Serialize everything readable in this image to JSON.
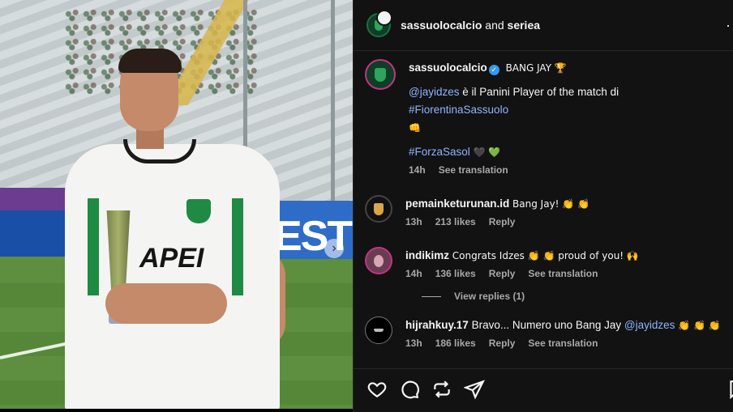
{
  "header": {
    "account": "sassuolocalcio",
    "joiner": "and",
    "collaborator": "seriea",
    "more": "·"
  },
  "photo": {
    "sponsor": "APEI",
    "board_text": "EST"
  },
  "caption": {
    "username": "sassuolocalcio",
    "verified": "✓",
    "title": "BANG JAY 🏆",
    "mention": "@jayidzes",
    "text": " è il Panini Player of the match di ",
    "hashtag": "#FiorentinaSassuolo",
    "emoji_line": "👊",
    "tag2": "#ForzaSasol",
    "tag2_emoji": "🖤 💚",
    "time": "14h",
    "translate": "See translation"
  },
  "comments": [
    {
      "username": "pemainketurunan.id",
      "text": "Bang Jay! 👏 👏",
      "time": "13h",
      "likes": "213 likes",
      "reply": "Reply",
      "translate": ""
    },
    {
      "username": "indikimz",
      "text": "Congrats Idzes 👏 👏 proud of you! 🙌",
      "time": "14h",
      "likes": "136 likes",
      "reply": "Reply",
      "translate": "See translation",
      "view_replies": "View replies (1)"
    },
    {
      "username": "hijrahkuy.17",
      "text_pre": "Bravo... Numero uno Bang Jay ",
      "mention": "@jayidzes",
      "text_post": " 👏 👏 👏",
      "time": "13h",
      "likes": "186 likes",
      "reply": "Reply",
      "translate": "See translation"
    }
  ],
  "actions": {
    "like": "heart-icon",
    "comment": "comment-icon",
    "repost": "repost-icon",
    "share": "share-icon",
    "save": "bookmark-icon"
  },
  "colors": {
    "panel_bg": "#121212",
    "link": "#8fb4ff",
    "meta": "#a8a8a8",
    "club_green": "#1f8a43"
  }
}
